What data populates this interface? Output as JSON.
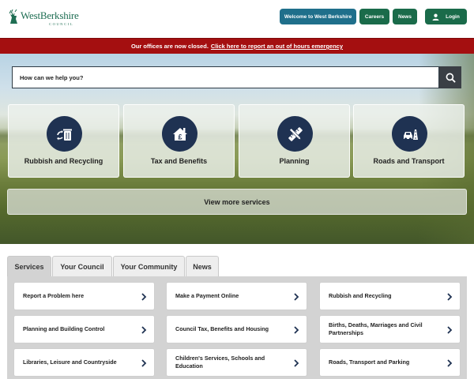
{
  "header": {
    "logo_text": "WestBerkshire",
    "logo_sub": "COUNCIL",
    "buttons": {
      "welcome": "Welcome to West Berkshire",
      "careers": "Careers",
      "news": "News",
      "login": "Login"
    }
  },
  "alert": {
    "text": "Our offices are now closed.",
    "link": "Click here to report an out of hours emergency"
  },
  "search": {
    "placeholder": "How can we help you?",
    "icon": "search-icon"
  },
  "cards": [
    {
      "label": "Rubbish and Recycling",
      "icon": "recycling-bin-icon"
    },
    {
      "label": "Tax and Benefits",
      "icon": "house-pound-icon"
    },
    {
      "label": "Planning",
      "icon": "pencil-ruler-icon"
    },
    {
      "label": "Roads and Transport",
      "icon": "car-road-icon"
    }
  ],
  "view_more": "View more services",
  "tabs": [
    {
      "label": "Services",
      "active": true
    },
    {
      "label": "Your Council",
      "active": false
    },
    {
      "label": "Your Community",
      "active": false
    },
    {
      "label": "News",
      "active": false
    }
  ],
  "services": [
    [
      "Report a Problem here",
      "Make a Payment Online",
      "Rubbish and Recycling"
    ],
    [
      "Planning and Building Control",
      "Council Tax, Benefits and Housing",
      "Births, Deaths, Marriages and Civil Partnerships"
    ],
    [
      "Libraries, Leisure and Countryside",
      "Children's Services, Schools and Education",
      "Roads, Transport and Parking"
    ]
  ],
  "colors": {
    "brand_green": "#1a6b4a",
    "welcome_blue": "#1f6f8b",
    "alert_red": "#a40f10",
    "icon_navy": "#1f3252"
  }
}
